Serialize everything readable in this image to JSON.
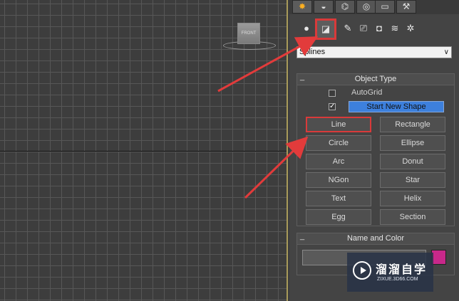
{
  "viewport": {
    "viewcube_label": "FRONT"
  },
  "command_panel": {
    "tabs": [
      {
        "icon": "create-sun-icon",
        "glyph": "✸"
      },
      {
        "icon": "modify-icon",
        "glyph": "◒"
      },
      {
        "icon": "hierarchy-icon",
        "glyph": "⌬"
      },
      {
        "icon": "motion-icon",
        "glyph": "◎"
      },
      {
        "icon": "display-icon",
        "glyph": "▭"
      },
      {
        "icon": "utilities-hammer-icon",
        "glyph": "⚒"
      }
    ],
    "sub_icons": [
      {
        "icon": "geometry-sphere-icon",
        "glyph": "●"
      },
      {
        "icon": "shapes-icon",
        "glyph": "◪",
        "selected": true
      },
      {
        "icon": "lights-icon",
        "glyph": "✎"
      },
      {
        "icon": "cameras-icon",
        "glyph": "⎚"
      },
      {
        "icon": "helpers-icon",
        "glyph": "◘"
      },
      {
        "icon": "spacewarps-icon",
        "glyph": "≋"
      },
      {
        "icon": "systems-icon",
        "glyph": "✲"
      }
    ],
    "category_dropdown": {
      "value": "Splines",
      "chevron": "∨"
    },
    "object_type": {
      "header": "Object Type",
      "toggle": "_",
      "autogrid_label": "AutoGrid",
      "autogrid_checked": false,
      "start_new_shape_checked": true,
      "start_new_shape_label": "Start New Shape",
      "check_mark": "✓",
      "buttons": [
        [
          "Line",
          "Rectangle"
        ],
        [
          "Circle",
          "Ellipse"
        ],
        [
          "Arc",
          "Donut"
        ],
        [
          "NGon",
          "Star"
        ],
        [
          "Text",
          "Helix"
        ],
        [
          "Egg",
          "Section"
        ]
      ]
    },
    "name_and_color": {
      "header": "Name and Color",
      "toggle": "_",
      "swatch_color": "#c8288a"
    }
  },
  "watermark": {
    "main": "溜溜自学",
    "sub": "ZIXUE.3D66.COM"
  },
  "colors": {
    "highlight_red": "#d93a3a",
    "accent_blue": "#3d80dd"
  }
}
